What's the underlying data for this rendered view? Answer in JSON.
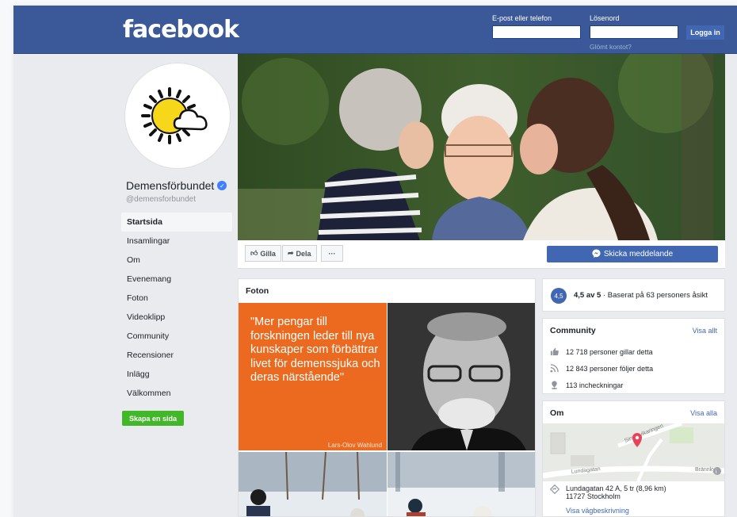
{
  "topbar": {
    "logo": "facebook",
    "email_label": "E-post eller telefon",
    "password_label": "Lösenord",
    "login_button": "Logga in",
    "forgot_link": "Glömt kontot?"
  },
  "profile": {
    "name": "Demensförbundet",
    "handle": "@demensforbundet",
    "verified_icon": "✓"
  },
  "nav": {
    "items": [
      "Startsida",
      "Insamlingar",
      "Om",
      "Evenemang",
      "Foton",
      "Videoklipp",
      "Community",
      "Recensioner",
      "Inlägg",
      "Välkommen"
    ],
    "active_index": 0,
    "create_page": "Skapa en sida"
  },
  "actions": {
    "like": "Gilla",
    "share": "Dela",
    "more": "···",
    "message": "Skicka meddelande"
  },
  "photos": {
    "title": "Foton",
    "quote": "\"Mer pengar till forskningen leder till nya kunskaper som förbättrar livet för demenssjuka och deras närstående\"",
    "quote_author": "Lars-Olov Wahlund"
  },
  "rating": {
    "badge": "4,5",
    "score": "4,5 av 5",
    "text": " · Baserat på 63 personers åsikt"
  },
  "community": {
    "title": "Community",
    "link": "Visa allt",
    "likes": "12 718 personer gillar detta",
    "follows": "12 843 personer följer detta",
    "checkins": "113 incheckningar"
  },
  "about": {
    "title": "Om",
    "link": "Visa alla",
    "map_street1": "Sinnervikaringen",
    "map_street2": "Lundagatan",
    "map_street3": "Brännkyr",
    "address_line1": "Lundagatan 42 A, 5 tr (8,96 km)",
    "address_line2": "11727 Stockholm",
    "directions": "Visa vägbeskrivning"
  },
  "colors": {
    "brand_blue": "#3b5998",
    "button_blue": "#4267b2",
    "green": "#42b72a",
    "quote_orange": "#ec6a1f"
  }
}
